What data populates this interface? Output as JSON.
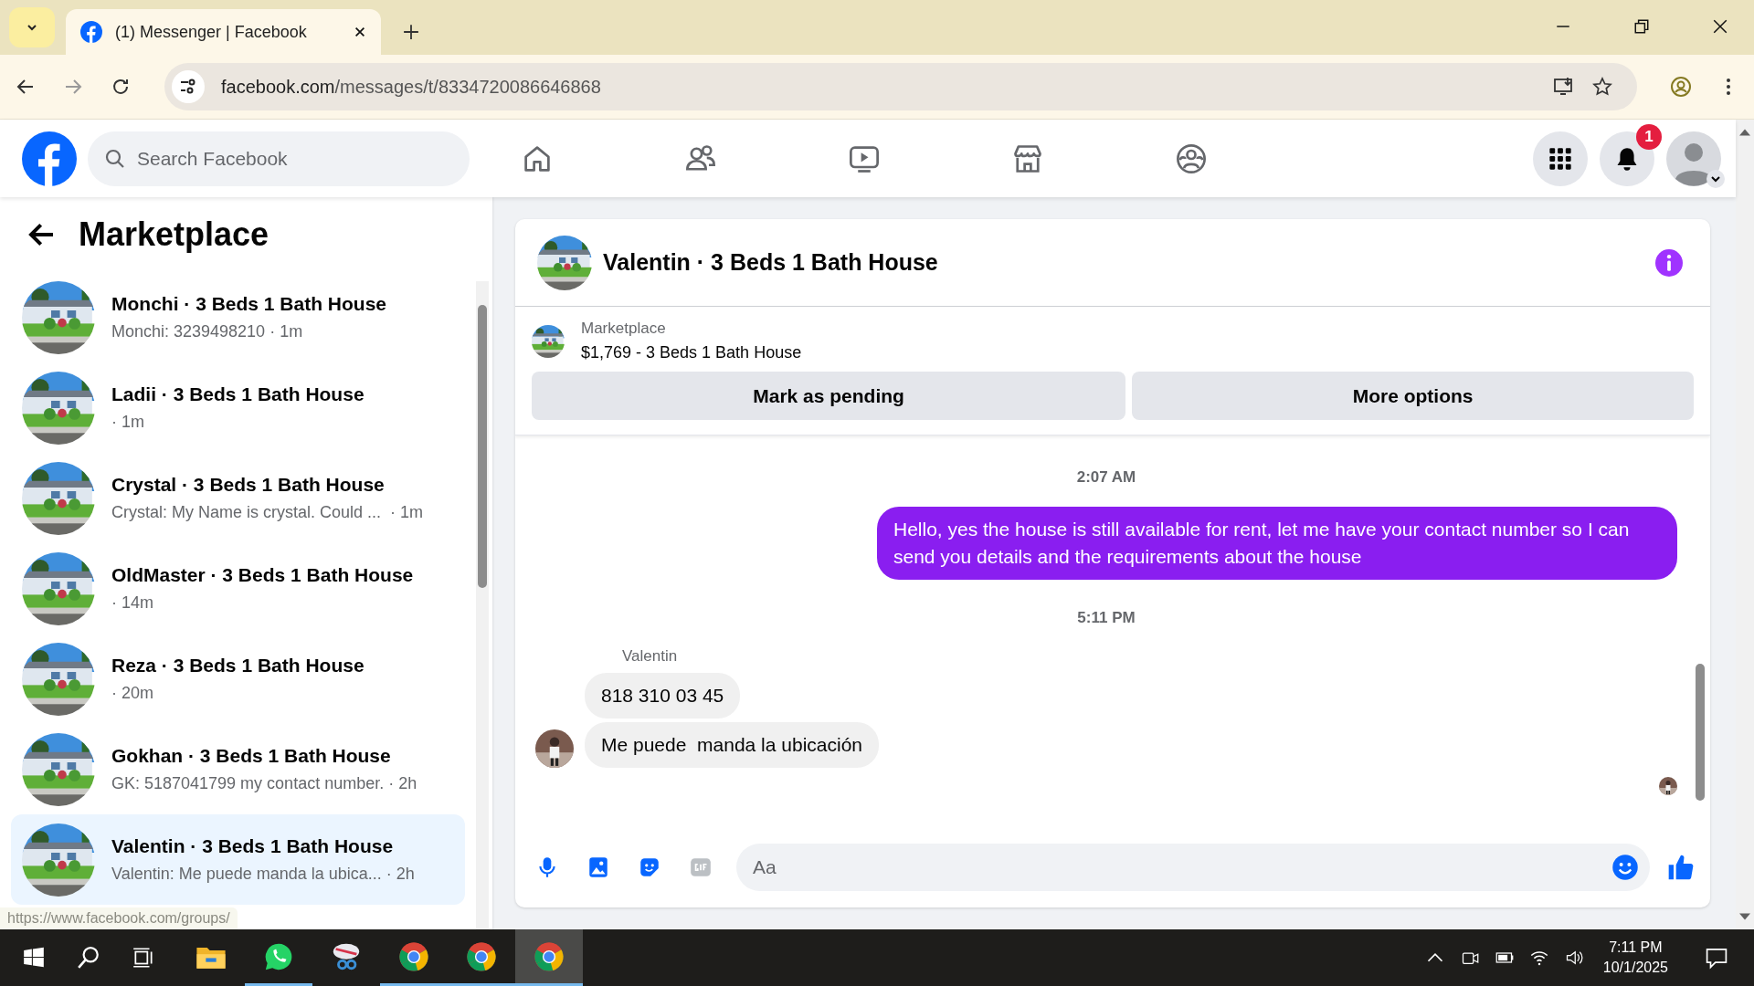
{
  "browser": {
    "tab_title": "(1) Messenger | Facebook",
    "url_host": "facebook.com",
    "url_path": "/messages/t/8334720086646868",
    "status_url": "https://www.facebook.com/groups/"
  },
  "header": {
    "search_placeholder": "Search Facebook",
    "notification_count": "1"
  },
  "sidebar": {
    "title": "Marketplace",
    "conversations": [
      {
        "name": "Monchi · 3 Beds 1 Bath House",
        "preview": "Monchi: 3239498210 · 1m",
        "selected": false
      },
      {
        "name": "Ladii · 3 Beds 1 Bath House",
        "preview": "· 1m",
        "selected": false
      },
      {
        "name": "Crystal · 3 Beds 1 Bath House",
        "preview": "Crystal: My Name is crystal. Could ...  · 1m",
        "selected": false
      },
      {
        "name": "OldMaster · 3 Beds 1 Bath House",
        "preview": "· 14m",
        "selected": false
      },
      {
        "name": "Reza · 3 Beds 1 Bath House",
        "preview": "· 20m",
        "selected": false
      },
      {
        "name": "Gokhan · 3 Beds 1 Bath House",
        "preview": "GK: 5187041799 my contact number. · 2h",
        "selected": false
      },
      {
        "name": "Valentin · 3 Beds 1 Bath House",
        "preview": "Valentin: Me puede manda la ubica... · 2h",
        "selected": true
      }
    ]
  },
  "chat": {
    "title": "Valentin · 3 Beds 1 Bath House",
    "listing": {
      "label": "Marketplace",
      "text": "$1,769 - 3 Beds 1 Bath House"
    },
    "buttons": [
      "Mark as pending",
      "More options"
    ],
    "messages": [
      {
        "kind": "time",
        "text": "2:07 AM"
      },
      {
        "kind": "outgoing",
        "text": "Hello, yes the house is still available for rent, let me have your contact number so I can send you details and the requirements about the house"
      },
      {
        "kind": "time",
        "text": "5:11 PM"
      },
      {
        "kind": "sender",
        "text": "Valentin"
      },
      {
        "kind": "incoming",
        "text": "818 310 03 45",
        "avatar": false
      },
      {
        "kind": "incoming",
        "text": "Me puede  manda la ubicación",
        "avatar": true
      }
    ],
    "composer_placeholder": "Aa"
  },
  "taskbar": {
    "apps": [
      {
        "kind": "explorer",
        "running": false,
        "selected": false
      },
      {
        "kind": "whatsapp",
        "running": true,
        "selected": false
      },
      {
        "kind": "snip",
        "running": false,
        "selected": false
      },
      {
        "kind": "chrome",
        "running": true,
        "selected": false
      },
      {
        "kind": "chrome",
        "running": true,
        "selected": false
      },
      {
        "kind": "chrome",
        "running": true,
        "selected": true
      }
    ],
    "time": "7:11 PM",
    "date": "10/1/2025"
  }
}
